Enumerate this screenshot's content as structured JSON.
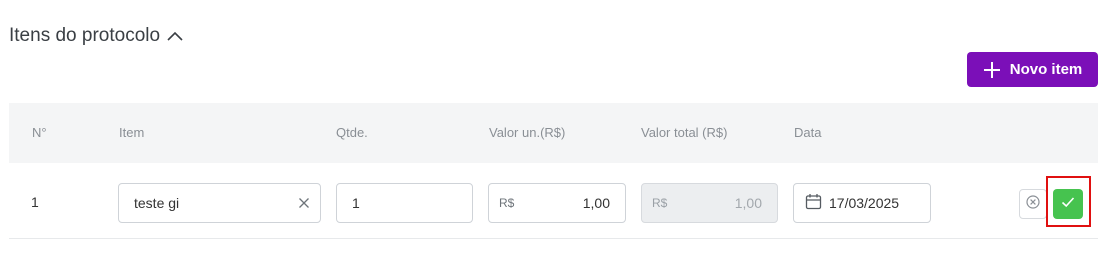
{
  "section": {
    "title": "Itens do protocolo",
    "toggle_icon": "chevron-up-icon"
  },
  "toolbar": {
    "new_item_label": "Novo item",
    "new_item_icon": "plus-icon",
    "accent_color": "#7b0fb8"
  },
  "table": {
    "headers": [
      "N°",
      "Item",
      "Qtde.",
      "Valor un.(R$)",
      "Valor total (R$)",
      "Data"
    ],
    "rows": [
      {
        "number": "1",
        "item": "teste gi",
        "quantity": "1",
        "unit_prefix": "R$",
        "unit_value": "1,00",
        "total_prefix": "R$",
        "total_value": "1,00",
        "date": "17/03/2025",
        "actions": {
          "cancel_icon": "close-circle-icon",
          "confirm_icon": "check-icon",
          "confirm_color": "#46c34f"
        }
      }
    ]
  }
}
